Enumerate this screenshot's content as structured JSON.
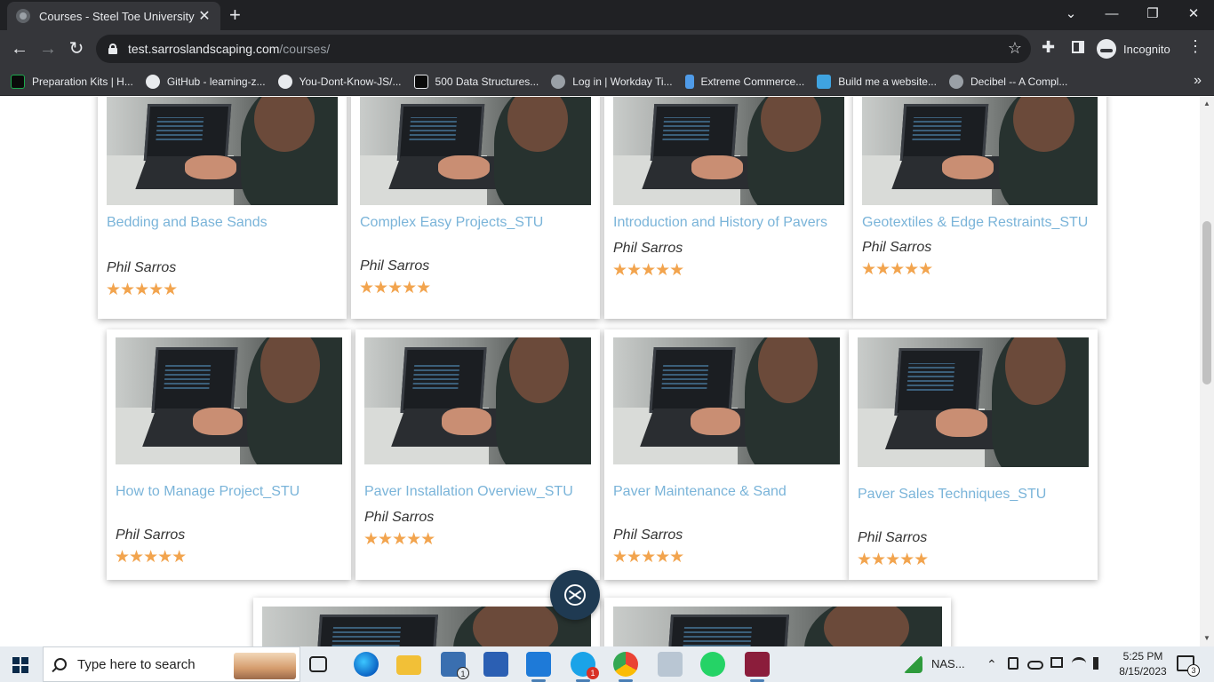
{
  "window": {
    "tab_title": "Courses - Steel Toe University",
    "tab_close": "✕",
    "newtab": "+",
    "minimize": "⌄",
    "min": "—",
    "restore": "❐",
    "close": "✕"
  },
  "toolbar": {
    "back": "←",
    "forward": "→",
    "reload": "↻",
    "url_host": "test.sarroslandscaping.com",
    "url_path": "/courses/",
    "star": "☆",
    "extensions": "✚",
    "incognito_label": "Incognito",
    "menu": "⋮"
  },
  "bookmarks": [
    {
      "label": "Preparation Kits | H...",
      "icon": "hackerrank-icon",
      "color": "#0a0a0a"
    },
    {
      "label": "GitHub - learning-z...",
      "icon": "github-icon",
      "color": "#e8eaed"
    },
    {
      "label": "You-Dont-Know-JS/...",
      "icon": "github-icon",
      "color": "#e8eaed"
    },
    {
      "label": "500 Data Structures...",
      "icon": "medium-icon",
      "color": "#0a0a0a"
    },
    {
      "label": "Log in | Workday Ti...",
      "icon": "globe-icon",
      "color": "#9aa0a6"
    },
    {
      "label": "Extreme Commerce...",
      "icon": "ec-icon",
      "color": "#4f9be8"
    },
    {
      "label": "Build me a website...",
      "icon": "fiverr-icon",
      "color": "#3fa3e0"
    },
    {
      "label": "Decibel -- A Compl...",
      "icon": "globe-icon",
      "color": "#9aa0a6"
    }
  ],
  "bookmarks_more": "»",
  "courses": [
    {
      "title": "Bedding and Base Sands",
      "author": "Phil Sarros",
      "stars": "★★★★★",
      "rating": 5
    },
    {
      "title": "Complex Easy Projects_STU",
      "author": "Phil Sarros",
      "stars": "★★★★★",
      "rating": 5
    },
    {
      "title": "Introduction and History of Pavers",
      "author": "Phil Sarros",
      "stars": "★★★★★",
      "rating": 5
    },
    {
      "title": "Geotextiles & Edge Restraints_STU",
      "author": "Phil Sarros",
      "stars": "★★★★★",
      "rating": 5
    },
    {
      "title": "How to Manage Project_STU",
      "author": "Phil Sarros",
      "stars": "★★★★★",
      "rating": 5
    },
    {
      "title": "Paver Installation Overview_STU",
      "author": "Phil Sarros",
      "stars": "★★★★★",
      "rating": 5
    },
    {
      "title": "Paver Maintenance & Sand",
      "author": "Phil Sarros",
      "stars": "★★★★★",
      "rating": 5
    },
    {
      "title": "Paver Sales Techniques_STU",
      "author": "Phil Sarros",
      "stars": "★★★★★",
      "rating": 5
    }
  ],
  "scrollbar": {
    "up": "▲",
    "down": "▼"
  },
  "taskbar": {
    "search_placeholder": "Type here to search",
    "mail_badge": "1",
    "skype_badge": "1",
    "stock_label": "NAS...",
    "tray_chevron": "⌃",
    "time": "5:25 PM",
    "date": "8/15/2023",
    "notifications_count": "3"
  },
  "colors": {
    "accent_title": "#7ab4d9",
    "star": "#f2a44e",
    "chrome_dark": "#202124",
    "chrome_toolbar": "#35363a"
  }
}
